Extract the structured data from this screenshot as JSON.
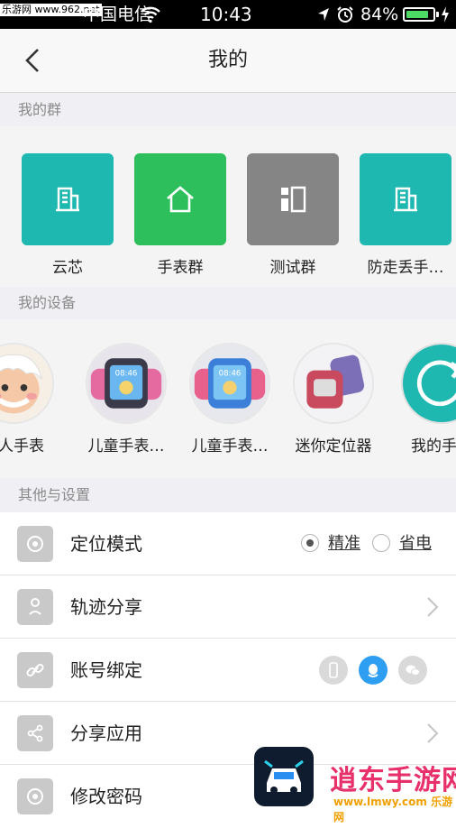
{
  "status_bar": {
    "watermark": "乐游网 www.962.net",
    "carrier": "中国电信",
    "time": "10:43",
    "battery": "84%",
    "battery_level": 0.84
  },
  "nav": {
    "title": "我的",
    "back_icon": "chevron-left-icon"
  },
  "groups_section": {
    "header": "我的群",
    "items": [
      {
        "label": "云芯",
        "color": "#1fb8b0",
        "icon": "building-icon"
      },
      {
        "label": "手表群",
        "color": "#2cbf5c",
        "icon": "home-icon"
      },
      {
        "label": "测试群",
        "color": "#858585",
        "icon": "grid-icon"
      },
      {
        "label": "防走丢手…",
        "color": "#1fb8b0",
        "icon": "building-icon"
      }
    ]
  },
  "devices_section": {
    "header": "我的设备",
    "items": [
      {
        "label": "老人手表",
        "avatar": "grandpa-avatar"
      },
      {
        "label": "儿童手表…",
        "avatar": "kids-watch-pink-avatar"
      },
      {
        "label": "儿童手表…",
        "avatar": "kids-watch-blue-avatar"
      },
      {
        "label": "迷你定位器",
        "avatar": "mini-locator-avatar"
      },
      {
        "label": "我的手表",
        "avatar": "refresh-avatar"
      }
    ]
  },
  "settings_section": {
    "header": "其他与设置",
    "rows": [
      {
        "label": "定位模式",
        "icon": "location-mode-icon",
        "options": [
          {
            "label": "精准",
            "selected": true
          },
          {
            "label": "省电",
            "selected": false
          }
        ]
      },
      {
        "label": "轨迹分享",
        "icon": "track-share-icon"
      },
      {
        "label": "账号绑定",
        "icon": "link-icon",
        "bindings": [
          "phone-icon",
          "qq-icon",
          "wechat-icon"
        ]
      },
      {
        "label": "分享应用",
        "icon": "share-icon"
      },
      {
        "label": "修改密码",
        "icon": "password-icon"
      }
    ]
  },
  "promo": {
    "brand": "逍东手游网",
    "site": "www.lmwy.com 乐游网"
  },
  "colors": {
    "accent_blue": "#2e9ef2",
    "section_bg": "#efeff4"
  }
}
